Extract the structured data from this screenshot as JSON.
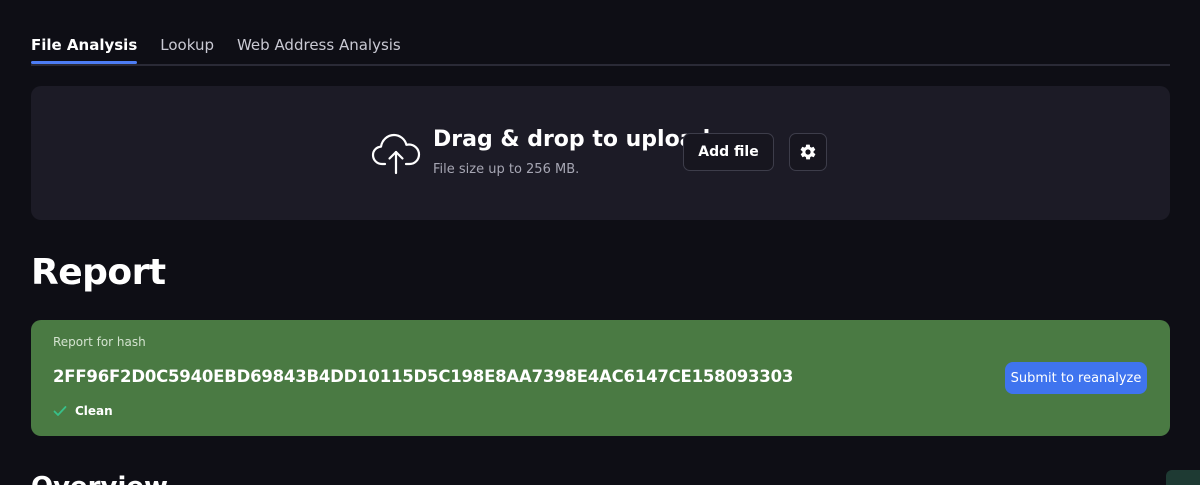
{
  "tabs": [
    {
      "label": "File Analysis",
      "active": true
    },
    {
      "label": "Lookup",
      "active": false
    },
    {
      "label": "Web Address Analysis",
      "active": false
    }
  ],
  "upload": {
    "title": "Drag & drop to upload",
    "subtitle": "File size up to 256 MB.",
    "add_file_label": "Add file",
    "icon": "cloud-upload-icon",
    "settings_icon": "gear-icon"
  },
  "report": {
    "heading": "Report",
    "label": "Report for hash",
    "hash": "2FF96F2D0C5940EBD69843B4DD10115D5C198E8AA7398E4AC6147CE158093303",
    "status": "Clean",
    "status_icon": "checkmark-icon",
    "reanalyze_label": "Submit to reanalyze"
  },
  "overview": {
    "heading": "Overview"
  },
  "colors": {
    "background": "#0e0e15",
    "card": "#1c1b26",
    "accent": "#4d7df5",
    "clean_card": "#4a7a43",
    "button_blue": "#3f74ef"
  }
}
